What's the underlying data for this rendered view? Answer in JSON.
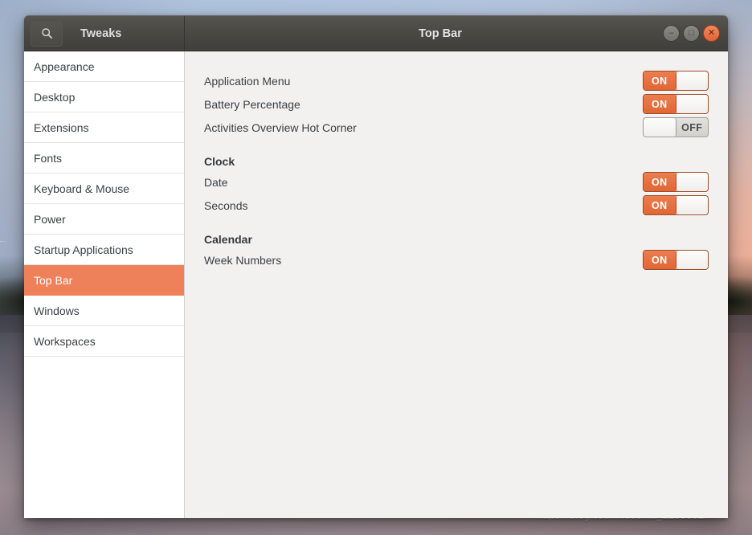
{
  "desktop": {
    "watermark": "https://blog.csdn.net/sina_21553627"
  },
  "window": {
    "app_name": "Tweaks",
    "title": "Top Bar",
    "search_icon": "search-icon",
    "controls": {
      "minimize": "minimize-icon",
      "minimize_glyph": "–",
      "maximize": "maximize-icon",
      "maximize_glyph": "□",
      "close": "close-icon",
      "close_glyph": "✕"
    }
  },
  "sidebar": {
    "items": [
      {
        "label": "Appearance",
        "selected": false
      },
      {
        "label": "Desktop",
        "selected": false
      },
      {
        "label": "Extensions",
        "selected": false
      },
      {
        "label": "Fonts",
        "selected": false
      },
      {
        "label": "Keyboard & Mouse",
        "selected": false
      },
      {
        "label": "Power",
        "selected": false
      },
      {
        "label": "Startup Applications",
        "selected": false
      },
      {
        "label": "Top Bar",
        "selected": true
      },
      {
        "label": "Windows",
        "selected": false
      },
      {
        "label": "Workspaces",
        "selected": false
      }
    ]
  },
  "content": {
    "top_rows": [
      {
        "label": "Application Menu",
        "state": "ON"
      },
      {
        "label": "Battery Percentage",
        "state": "ON"
      },
      {
        "label": "Activities Overview Hot Corner",
        "state": "OFF"
      }
    ],
    "clock_header": "Clock",
    "clock_rows": [
      {
        "label": "Date",
        "state": "ON"
      },
      {
        "label": "Seconds",
        "state": "ON"
      }
    ],
    "calendar_header": "Calendar",
    "calendar_rows": [
      {
        "label": "Week Numbers",
        "state": "ON"
      }
    ]
  },
  "colors": {
    "accent": "#ee8159",
    "switch_on": "#e06734",
    "titlebar": "#4b4a45",
    "content_bg": "#f2f1f0",
    "sidebar_bg": "#ffffff"
  }
}
